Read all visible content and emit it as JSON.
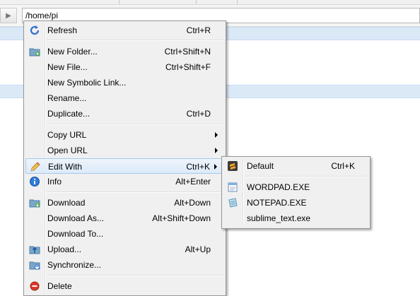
{
  "address_bar": {
    "path": "/home/pi"
  },
  "context_menu": {
    "items": [
      {
        "label": "Refresh",
        "shortcut": "Ctrl+R"
      },
      {
        "label": "New Folder...",
        "shortcut": "Ctrl+Shift+N"
      },
      {
        "label": "New File...",
        "shortcut": "Ctrl+Shift+F"
      },
      {
        "label": "New Symbolic Link...",
        "shortcut": ""
      },
      {
        "label": "Rename...",
        "shortcut": ""
      },
      {
        "label": "Duplicate...",
        "shortcut": "Ctrl+D"
      },
      {
        "label": "Copy URL",
        "shortcut": ""
      },
      {
        "label": "Open URL",
        "shortcut": ""
      },
      {
        "label": "Edit With",
        "shortcut": "Ctrl+K"
      },
      {
        "label": "Info",
        "shortcut": "Alt+Enter"
      },
      {
        "label": "Download",
        "shortcut": "Alt+Down"
      },
      {
        "label": "Download As...",
        "shortcut": "Alt+Shift+Down"
      },
      {
        "label": "Download To...",
        "shortcut": ""
      },
      {
        "label": "Upload...",
        "shortcut": "Alt+Up"
      },
      {
        "label": "Synchronize...",
        "shortcut": ""
      },
      {
        "label": "Delete",
        "shortcut": ""
      }
    ]
  },
  "edit_with_submenu": {
    "items": [
      {
        "label": "Default",
        "shortcut": "Ctrl+K"
      },
      {
        "label": "WORDPAD.EXE",
        "shortcut": ""
      },
      {
        "label": "NOTEPAD.EXE",
        "shortcut": ""
      },
      {
        "label": "sublime_text.exe",
        "shortcut": ""
      }
    ]
  },
  "colors": {
    "highlight": "#dceafa",
    "menu_bg": "#f0f0f0",
    "row_band": "#dbe9f7"
  }
}
